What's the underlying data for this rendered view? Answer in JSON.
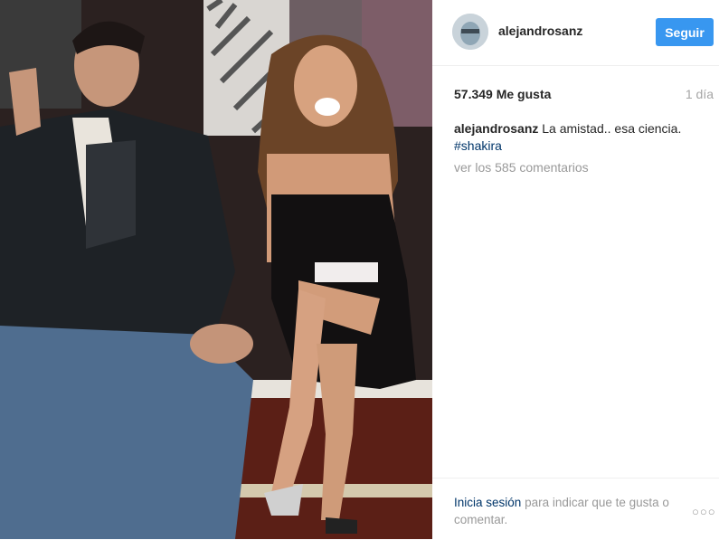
{
  "header": {
    "username": "alejandrosanz",
    "follow_label": "Seguir"
  },
  "stats": {
    "likes": "57.349 Me gusta",
    "time": "1 día"
  },
  "caption": {
    "username": "alejandrosanz",
    "text": "La amistad.. esa ciencia.",
    "hashtag": "#shakira"
  },
  "comments": {
    "label": "ver los 585 comentarios"
  },
  "footer": {
    "login_label": "Inicia sesión",
    "rest": "para indicar que te gusta o comentar.",
    "more_label": "○○○"
  },
  "colors": {
    "accent": "#3897f0",
    "link": "#003569",
    "muted": "#999999"
  }
}
